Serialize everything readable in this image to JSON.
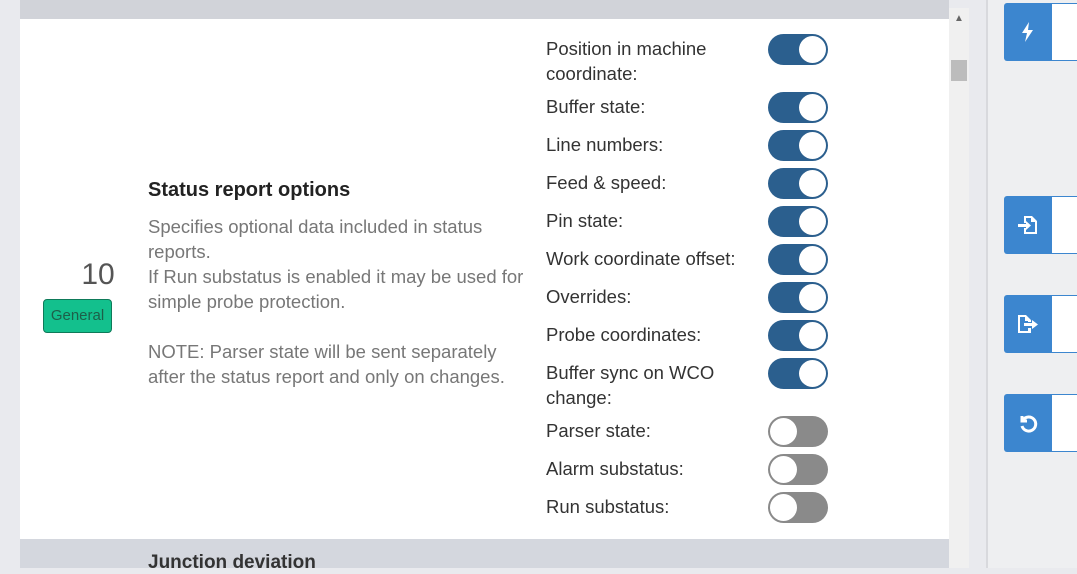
{
  "setting": {
    "number": "10",
    "category": "General",
    "title": "Status report options",
    "description": [
      "Specifies optional data included in status reports.",
      "If Run substatus is enabled it may be used for simple probe protection.",
      "",
      "NOTE: Parser state will be sent separately after the status report and only on changes."
    ],
    "options": [
      {
        "label": "Position in machine coordinate:",
        "enabled": true
      },
      {
        "label": "Buffer state:",
        "enabled": true
      },
      {
        "label": "Line numbers:",
        "enabled": true
      },
      {
        "label": "Feed & speed:",
        "enabled": true
      },
      {
        "label": "Pin state:",
        "enabled": true
      },
      {
        "label": "Work coordinate offset:",
        "enabled": true
      },
      {
        "label": "Overrides:",
        "enabled": true
      },
      {
        "label": "Probe coordinates:",
        "enabled": true
      },
      {
        "label": "Buffer sync on WCO change:",
        "enabled": true
      },
      {
        "label": "Parser state:",
        "enabled": false
      },
      {
        "label": "Alarm substatus:",
        "enabled": false
      },
      {
        "label": "Run substatus:",
        "enabled": false
      }
    ]
  },
  "next_setting": {
    "title": "Junction deviation"
  },
  "sidebar": {
    "buttons": [
      {
        "icon": "lightning-icon"
      },
      {
        "icon": "import-file-icon"
      },
      {
        "icon": "export-file-icon"
      },
      {
        "icon": "undo-icon"
      }
    ]
  },
  "colors": {
    "toggle_on": "#2b5f8e",
    "toggle_off": "#8a8a8a",
    "badge": "#13c08d",
    "action_button": "#3c86cf"
  }
}
